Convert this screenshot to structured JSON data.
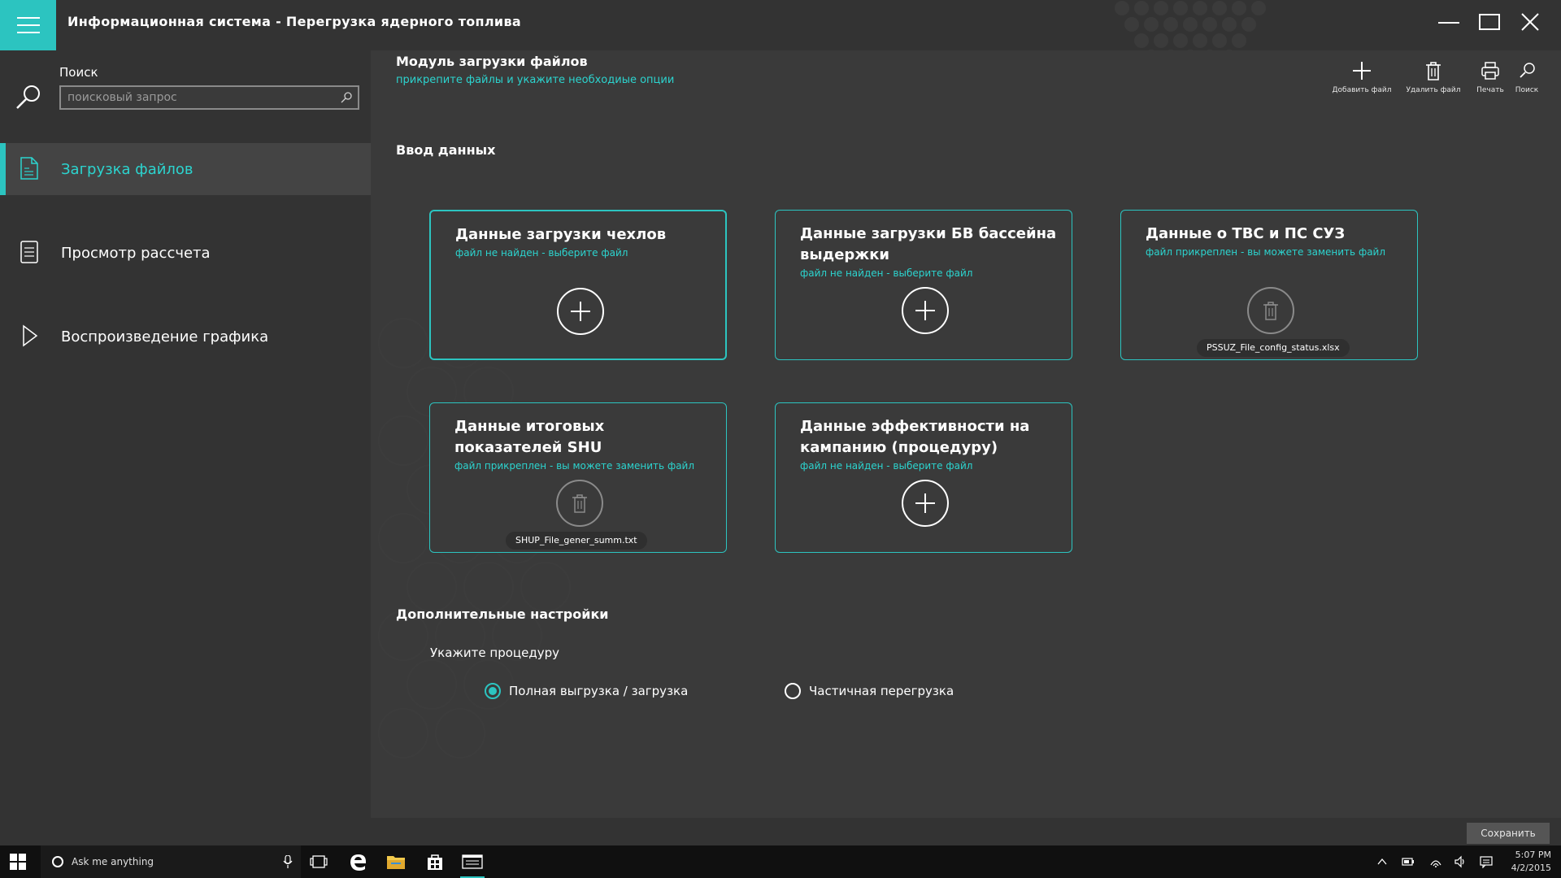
{
  "app": {
    "title": "Информационная система - Перегрузка ядерного топлива"
  },
  "sidebar": {
    "search_label": "Поиск",
    "search_placeholder": "поисковый запрос",
    "items": [
      {
        "label": "Загрузка файлов",
        "icon": "document-icon",
        "active": true
      },
      {
        "label": "Просмотр рассчета",
        "icon": "list-icon",
        "active": false
      },
      {
        "label": "Воспроизведение графика",
        "icon": "play-icon",
        "active": false
      }
    ]
  },
  "main": {
    "module_title": "Модуль загрузки файлов",
    "module_subtitle": "прикрепите файлы и укажите необходиые опции",
    "toolbar": {
      "add_label": "Добавить файл",
      "delete_label": "Удалить файл",
      "print_label": "Печать",
      "search_label": "Поиск"
    },
    "input_section_title": "Ввод данных",
    "cards": [
      {
        "title": "Данные загрузки чехлов",
        "status": "файл не найден - выберите файл",
        "action": "add",
        "file": ""
      },
      {
        "title": "Данные загрузки БВ бассейна выдержки",
        "status": "файл не найден - выберите файл",
        "action": "add",
        "file": ""
      },
      {
        "title": "Данные о ТВС и ПС СУЗ",
        "status": "файл прикреплен - вы можете заменить файл",
        "action": "delete",
        "file": "PSSUZ_File_config_status.xlsx"
      },
      {
        "title": "Данные итоговых показателей SHU",
        "status": "файл прикреплен - вы можете заменить файл",
        "action": "delete",
        "file": "SHUP_File_gener_summ.txt"
      },
      {
        "title": "Данные эффективности на кампанию (процедуру)",
        "status": "файл не найден - выберите файл",
        "action": "add",
        "file": ""
      }
    ],
    "settings_title": "Дополнительные настройки",
    "procedure_label": "Укажите процедуру",
    "radio_options": [
      {
        "label": "Полная выгрузка / загрузка",
        "checked": true
      },
      {
        "label": "Частичная  перегрузка",
        "checked": false
      }
    ],
    "save_label": "Сохранить"
  },
  "taskbar": {
    "search_text": "Ask me anything",
    "time": "5:07 PM",
    "date": "4/2/2015"
  },
  "colors": {
    "accent": "#2cc4c0",
    "accent_text": "#2cd4cf",
    "sidebar_bg": "#333333",
    "main_bg": "#3a3a3a"
  }
}
